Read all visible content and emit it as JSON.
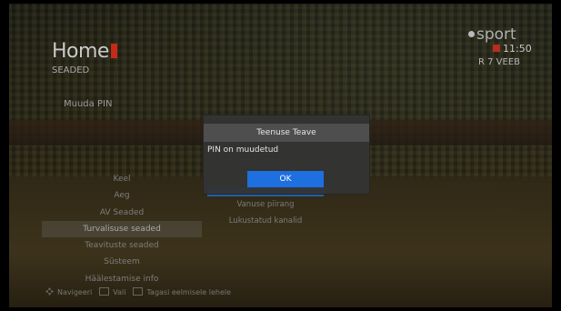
{
  "header": {
    "title": "Home",
    "section": "SEADED",
    "subtitle": "Muuda PIN"
  },
  "brand": {
    "logo_text": "sport",
    "time": "11:50",
    "date": "R 7 VEEB",
    "accent_color": "#c62a18"
  },
  "menu": {
    "items": [
      {
        "label": "Keel"
      },
      {
        "label": "Aeg"
      },
      {
        "label": "AV Seaded"
      },
      {
        "label": "Turvalisuse seaded",
        "active": true
      },
      {
        "label": "Teavituste seaded"
      },
      {
        "label": "Süsteem"
      },
      {
        "label": "Häälestamise info"
      }
    ]
  },
  "submenu": {
    "items": [
      {
        "label": "",
        "selected": true
      },
      {
        "label": "Vanuse piirang"
      },
      {
        "label": "Lukustatud kanalid"
      }
    ]
  },
  "dialog": {
    "title": "Teenuse Teave",
    "message": "PIN on muudetud",
    "ok_label": "OK",
    "button_color": "#1e6fe0"
  },
  "footer": {
    "navigate": "Navigeeri",
    "select": "Vali",
    "back": "Tagasi eelmisele lehele",
    "icons": [
      "dpad-icon",
      "ok-key-icon",
      "back-key-icon"
    ]
  }
}
